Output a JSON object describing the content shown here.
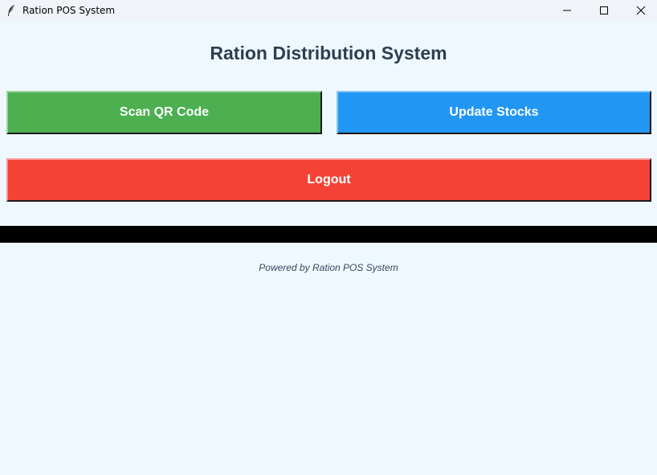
{
  "window": {
    "title": "Ration POS System",
    "app_icon": "feather-icon",
    "controls": [
      "minimize-icon",
      "maximize-icon",
      "close-icon"
    ]
  },
  "main": {
    "heading": "Ration Distribution System",
    "buttons": {
      "scan_qr": {
        "label": "Scan QR Code",
        "color": "#4caf50"
      },
      "update_stocks": {
        "label": "Update Stocks",
        "color": "#2196f3"
      },
      "logout": {
        "label": "Logout",
        "color": "#f44336"
      }
    }
  },
  "footer": {
    "text": "Powered by Ration POS System"
  },
  "colors": {
    "background": "#f0f8ff",
    "heading": "#2c3e50",
    "separator_bar": "#000000"
  }
}
